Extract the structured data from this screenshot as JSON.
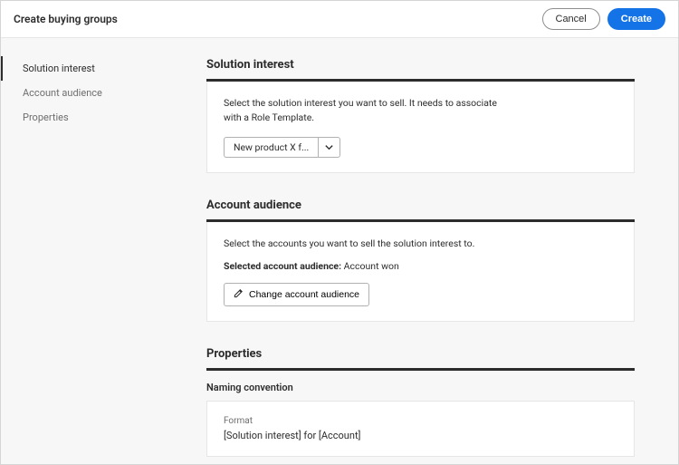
{
  "header": {
    "title": "Create buying groups",
    "cancel": "Cancel",
    "create": "Create"
  },
  "sidebar": {
    "items": [
      {
        "label": "Solution interest"
      },
      {
        "label": "Account audience"
      },
      {
        "label": "Properties"
      }
    ]
  },
  "solution": {
    "title": "Solution interest",
    "helper": "Select the solution interest you want to sell. It needs to associate with a Role Template.",
    "selected": "New product X f..."
  },
  "audience": {
    "title": "Account audience",
    "helper": "Select the accounts you want to sell the solution interest to.",
    "selected_label": "Selected account audience:",
    "selected_value": "Account won",
    "change_label": "Change account audience"
  },
  "properties": {
    "title": "Properties",
    "subheading": "Naming convention",
    "format_label": "Format",
    "format_value": "[Solution interest] for [Account]"
  }
}
